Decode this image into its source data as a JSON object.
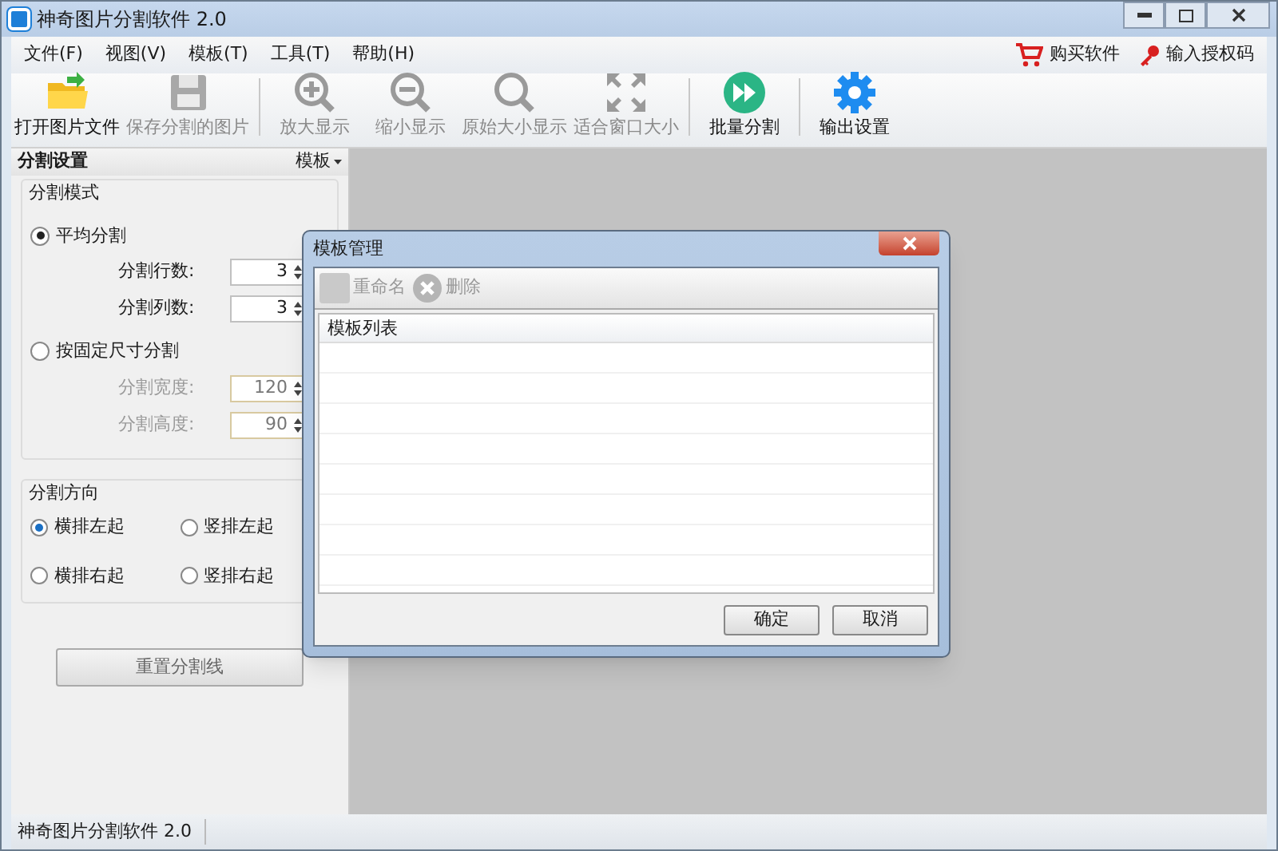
{
  "window": {
    "title": "神奇图片分割软件 2.0"
  },
  "menu": [
    "文件(F)",
    "视图(V)",
    "模板(T)",
    "工具(T)",
    "帮助(H)"
  ],
  "menu_links": [
    {
      "kind": "cart",
      "label": "购买软件"
    },
    {
      "kind": "key",
      "label": "输入授权码"
    }
  ],
  "toolbar": [
    {
      "kind": "open",
      "label": "打开图片文件",
      "disabled": false
    },
    {
      "kind": "save",
      "label": "保存分割的图片",
      "disabled": true
    },
    {
      "kind": "sep"
    },
    {
      "kind": "zoomin",
      "label": "放大显示",
      "disabled": true
    },
    {
      "kind": "zoomout",
      "label": "缩小显示",
      "disabled": true
    },
    {
      "kind": "zoom",
      "label": "原始大小显示",
      "disabled": true
    },
    {
      "kind": "fit",
      "label": "适合窗口大小",
      "disabled": true
    },
    {
      "kind": "sep"
    },
    {
      "kind": "batch",
      "label": "批量分割",
      "disabled": false
    },
    {
      "kind": "sep"
    },
    {
      "kind": "gear",
      "label": "输出设置",
      "disabled": false
    }
  ],
  "panel": {
    "title": "分割设置",
    "template_button": "模板",
    "mode_group": {
      "title": "分割模式",
      "options": [
        {
          "label": "平均分割",
          "selected": true,
          "fields": [
            {
              "label": "分割行数:",
              "value": "3",
              "disabled": false
            },
            {
              "label": "分割列数:",
              "value": "3",
              "disabled": false
            }
          ]
        },
        {
          "label": "按固定尺寸分割",
          "selected": false,
          "fields": [
            {
              "label": "分割宽度:",
              "value": "120",
              "disabled": true
            },
            {
              "label": "分割高度:",
              "value": "90",
              "disabled": true
            }
          ]
        }
      ]
    },
    "direction_group": {
      "title": "分割方向",
      "options": [
        {
          "label": "横排左起",
          "selected": true
        },
        {
          "label": "竖排左起",
          "selected": false
        },
        {
          "label": "横排右起",
          "selected": false
        },
        {
          "label": "竖排右起",
          "selected": false
        }
      ]
    },
    "reset_button": "重置分割线"
  },
  "dialog": {
    "title": "模板管理",
    "toolbar": [
      {
        "kind": "rename",
        "label": "重命名",
        "disabled": true
      },
      {
        "kind": "delete",
        "label": "删除",
        "disabled": true
      }
    ],
    "list_header": "模板列表",
    "buttons": [
      "确定",
      "取消"
    ]
  },
  "status_bar": "神奇图片分割软件 2.0"
}
